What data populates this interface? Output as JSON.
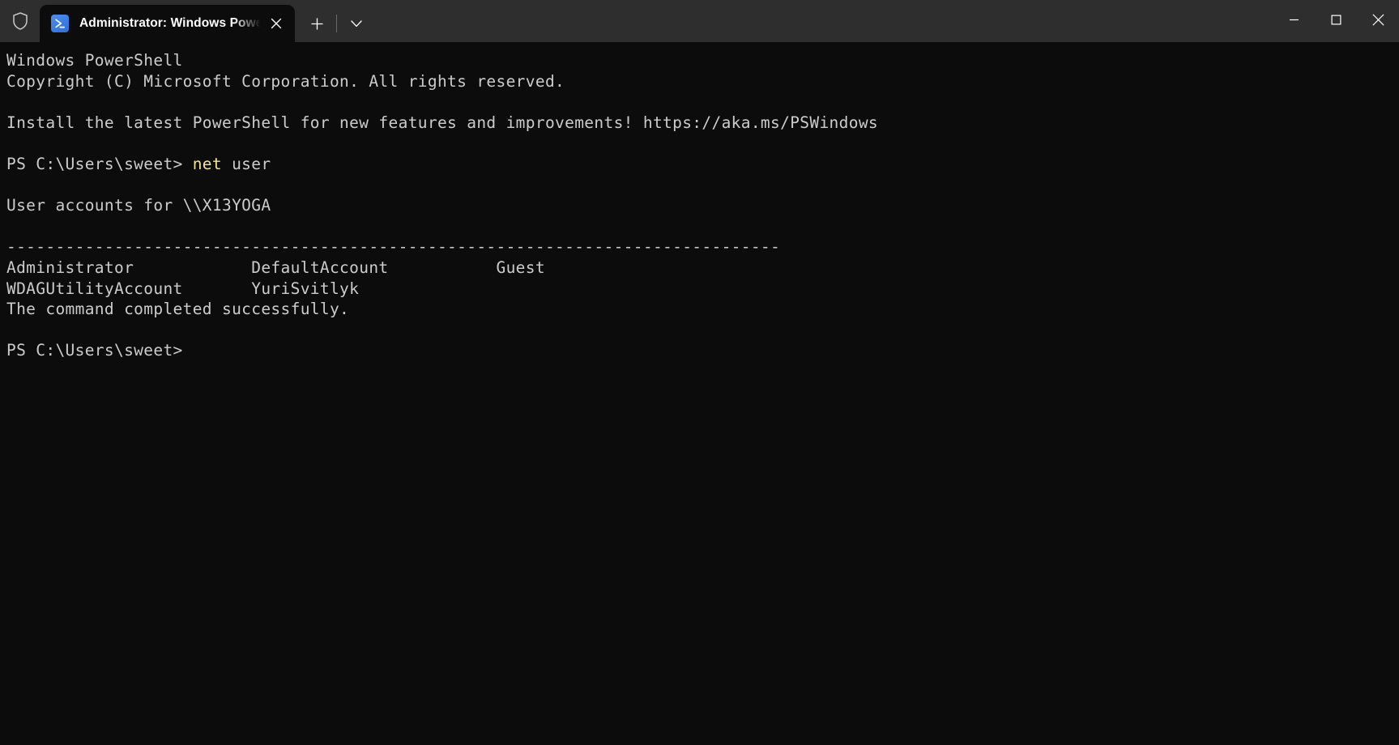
{
  "window": {
    "shield_icon": "shield-icon",
    "controls": {
      "minimize_label": "—",
      "maximize_label": "□",
      "close_label": "✕"
    }
  },
  "tabs": [
    {
      "title": "Administrator: Windows Powe",
      "full_title": "Administrator: Windows PowerShell",
      "icon": "powershell-icon",
      "close_label": "✕",
      "active": true
    }
  ],
  "tabbar": {
    "new_tab_label": "+",
    "dropdown_label": "⌄"
  },
  "colors": {
    "titlebar_bg": "#2e2e2e",
    "terminal_bg": "#0c0c0c",
    "foreground": "#cccccc",
    "accent_blue": "#3b78ff",
    "keyword_yellow": "#f0e68c",
    "tab_active_bg": "#0c0c0c"
  },
  "terminal": {
    "lines": [
      {
        "id": "banner-title",
        "text": "Windows PowerShell"
      },
      {
        "id": "banner-copyright",
        "text": "Copyright (C) Microsoft Corporation. All rights reserved."
      },
      {
        "id": "blank-1",
        "text": " "
      },
      {
        "id": "install-notice",
        "text": "Install the latest PowerShell for new features and improvements! https://aka.ms/PSWindows"
      },
      {
        "id": "blank-2",
        "text": " "
      },
      {
        "id": "prompt-1",
        "text": "PS C:\\Users\\sweet> ",
        "command": "net",
        "args": " user"
      },
      {
        "id": "blank-3",
        "text": " "
      },
      {
        "id": "accounts-header",
        "text": "User accounts for \\\\X13YOGA"
      },
      {
        "id": "blank-4",
        "text": " "
      },
      {
        "id": "separator",
        "text": "-------------------------------------------------------------------------------"
      },
      {
        "id": "accounts-row-1",
        "text": "Administrator            DefaultAccount           Guest"
      },
      {
        "id": "accounts-row-2",
        "text": "WDAGUtilityAccount       YuriSvitlyk"
      },
      {
        "id": "result-message",
        "text": "The command completed successfully."
      },
      {
        "id": "blank-5",
        "text": " "
      },
      {
        "id": "prompt-2",
        "text": "PS C:\\Users\\sweet>"
      }
    ],
    "command_output": {
      "host": "\\\\X13YOGA",
      "accounts": [
        "Administrator",
        "DefaultAccount",
        "Guest",
        "WDAGUtilityAccount",
        "YuriSvitlyk"
      ],
      "status": "The command completed successfully."
    }
  }
}
